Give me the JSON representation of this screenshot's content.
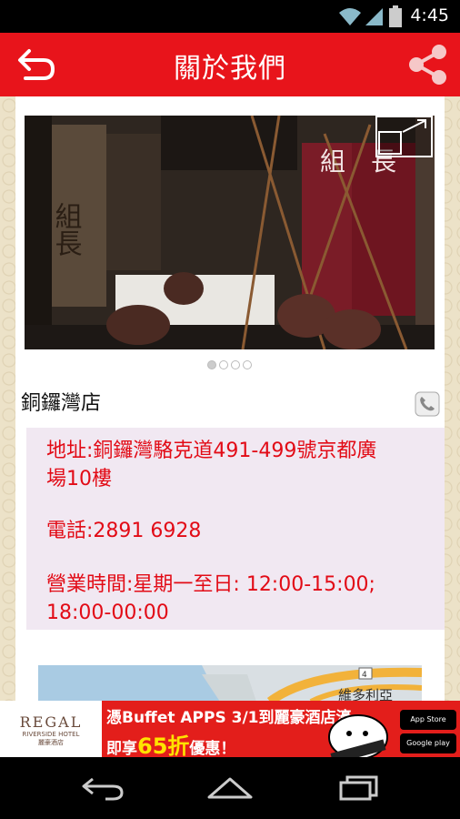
{
  "status_bar": {
    "time": "4:45"
  },
  "header": {
    "title": "關於我們"
  },
  "photo": {
    "sign_left": "組長",
    "sign_right": "組長",
    "dots_count": 4,
    "active_dot": 0
  },
  "store": {
    "name": "銅鑼灣店",
    "address_line1": "地址:銅鑼灣駱克道491-499號京都廣",
    "address_line2": "場10樓",
    "phone": "電話:2891 6928",
    "hours_line1": "營業時間:星期一至日: 12:00-15:00;",
    "hours_line2": "18:00-00:00"
  },
  "map": {
    "label": "維多利亞"
  },
  "ad": {
    "brand": "REGAL",
    "brand_sub1": "RIVERSIDE HOTEL",
    "brand_sub2": "麗豪酒店",
    "line1": "憑Buffet APPS 3/1到麗豪酒店濠",
    "line2_pre": "即享",
    "line2_highlight": "65折",
    "line2_post": "優惠！",
    "badge_appstore": "App Store",
    "badge_google": "Google play"
  },
  "colors": {
    "header": "#e8141b",
    "info_text": "#e20b16",
    "info_bg": "#f1e8f2"
  }
}
